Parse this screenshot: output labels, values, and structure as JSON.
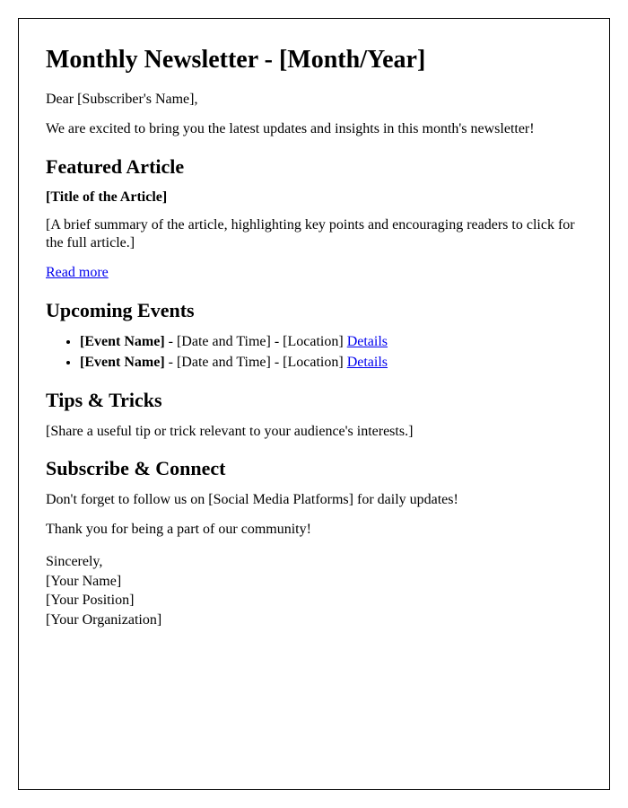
{
  "title": "Monthly Newsletter - [Month/Year]",
  "greeting": "Dear [Subscriber's Name],",
  "intro": "We are excited to bring you the latest updates and insights in this month's newsletter!",
  "featured": {
    "heading": "Featured Article",
    "article_title": "[Title of the Article]",
    "summary": "[A brief summary of the article, highlighting key points and encouraging readers to click for the full article.]",
    "read_more_label": "Read more"
  },
  "events": {
    "heading": "Upcoming Events",
    "items": [
      {
        "name": "[Event Name]",
        "sep1": " - ",
        "datetime": "[Date and Time]",
        "sep2": " - ",
        "location": "[Location]",
        "space": " ",
        "details_label": "Details"
      },
      {
        "name": "[Event Name]",
        "sep1": " - ",
        "datetime": "[Date and Time]",
        "sep2": " - ",
        "location": "[Location]",
        "space": " ",
        "details_label": "Details"
      }
    ]
  },
  "tips": {
    "heading": "Tips & Tricks",
    "body": "[Share a useful tip or trick relevant to your audience's interests.]"
  },
  "subscribe": {
    "heading": "Subscribe & Connect",
    "body": "Don't forget to follow us on [Social Media Platforms] for daily updates!"
  },
  "thanks": "Thank you for being a part of our community!",
  "signoff": {
    "closing": "Sincerely,",
    "name": "[Your Name]",
    "position": "[Your Position]",
    "organization": "[Your Organization]"
  }
}
